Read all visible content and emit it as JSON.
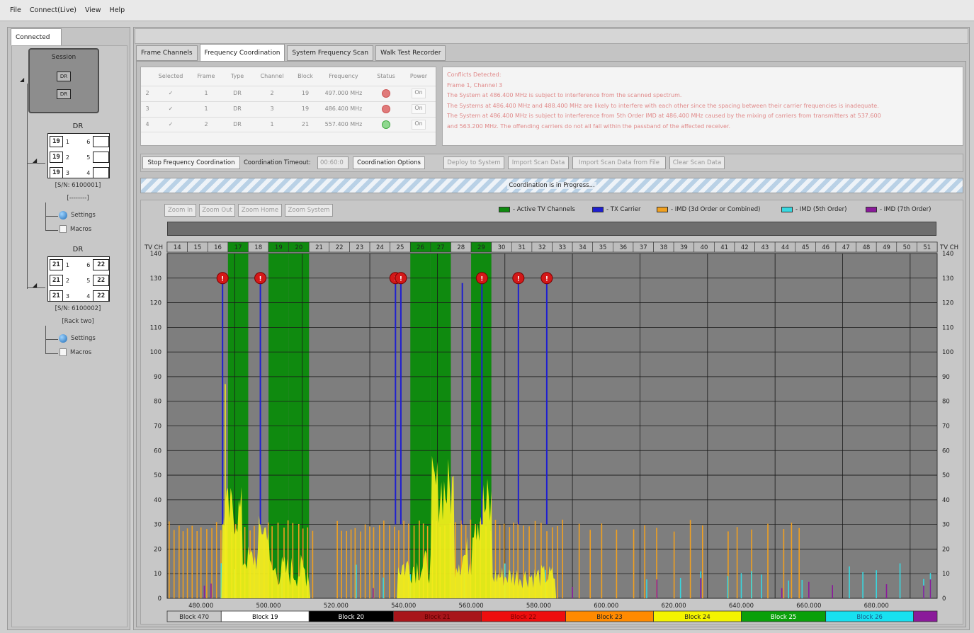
{
  "menu": [
    "File",
    "Connect(Live)",
    "View",
    "Help"
  ],
  "left": {
    "tab": "Connected",
    "session": {
      "label": "Session",
      "slots": [
        "DR",
        "DR"
      ]
    },
    "devices": [
      {
        "title": "DR",
        "rows": [
          [
            "19",
            "1",
            "6"
          ],
          [
            "19",
            "2",
            "5"
          ],
          [
            "19",
            "3",
            "4"
          ]
        ],
        "sn": "[S/N: 6100001]",
        "name": "[--------]"
      },
      {
        "title": "DR",
        "rows": [
          [
            "21",
            "1",
            "6",
            "22"
          ],
          [
            "21",
            "2",
            "5",
            "22"
          ],
          [
            "21",
            "3",
            "4",
            "22"
          ]
        ],
        "sn": "[S/N: 6100002]",
        "name": "[Rack two]"
      }
    ],
    "settings": "Settings",
    "macros": "Macros"
  },
  "tabs": [
    "Frame Channels",
    "Frequency Coordination",
    "System Frequency Scan",
    "Walk Test Recorder"
  ],
  "table": {
    "headers": [
      "Selected",
      "Frame",
      "Type",
      "Channel",
      "Block",
      "Frequency",
      "Status",
      "Power"
    ],
    "rows": [
      {
        "idx": "2",
        "selected": "✓",
        "frame": "1",
        "type": "DR",
        "channel": "2",
        "block": "19",
        "frequency": "497.000 MHz",
        "status": "red",
        "power": "On"
      },
      {
        "idx": "3",
        "selected": "✓",
        "frame": "1",
        "type": "DR",
        "channel": "3",
        "block": "19",
        "frequency": "486.400 MHz",
        "status": "red",
        "power": "On"
      },
      {
        "idx": "4",
        "selected": "✓",
        "frame": "2",
        "type": "DR",
        "channel": "1",
        "block": "21",
        "frequency": "557.400 MHz",
        "status": "green",
        "power": "On"
      }
    ]
  },
  "conflicts": [
    "Conflicts Detected:",
    "",
    "Frame 1, Channel 3",
    "The System at 486.400 MHz is subject to interference from the scanned spectrum.",
    "The Systems at 486.400 MHz and 488.400 MHz are likely to interfere with each other since the spacing between their carrier frequencies is inadequate.",
    "The System at 486.400 MHz is subject to interference from 5th Order IMD at 486.400 MHz caused by the mixing of carriers from transmitters at 537.600",
    "and 563.200 MHz. The offending carriers do not all fall within the passband of the affected receiver."
  ],
  "controls": {
    "stop": "Stop Frequency Coordination",
    "timeout_label": "Coordination Timeout:",
    "timeout_value": "00:60:0",
    "options": "Coordination Options",
    "deploy": "Deploy to System",
    "import_scan": "Import Scan Data",
    "import_file": "Import Scan Data from File",
    "clear": "Clear Scan Data"
  },
  "progress": "Coordination is in Progress...",
  "zoom": [
    "Zoom In",
    "Zoom Out",
    "Zoom Home",
    "Zoom System"
  ],
  "legend": [
    {
      "label": "- Active TV Channels",
      "color": "#0f8a0f"
    },
    {
      "label": "- TX Carrier",
      "color": "#1f1fcf"
    },
    {
      "label": "- IMD (3d Order or Combined)",
      "color": "#f0a020"
    },
    {
      "label": "- IMD (5th Order)",
      "color": "#38d8e0"
    },
    {
      "label": "- IMD (7th Order)",
      "color": "#8a1a9a"
    }
  ],
  "chart_data": {
    "type": "bar",
    "tv_ch_label": "TV CH",
    "tv_channels": [
      "14",
      "15",
      "16",
      "17",
      "18",
      "19",
      "20",
      "21",
      "22",
      "23",
      "24",
      "25",
      "26",
      "27",
      "28",
      "29",
      "30",
      "31",
      "32",
      "33",
      "34",
      "35",
      "36",
      "37",
      "38",
      "39",
      "40",
      "41",
      "42",
      "43",
      "44",
      "45",
      "46",
      "47",
      "48",
      "49",
      "50",
      "51"
    ],
    "active_tv_channels": [
      "17",
      "19",
      "20",
      "26",
      "27",
      "29"
    ],
    "xlim": [
      470,
      698
    ],
    "ylim": [
      0,
      140
    ],
    "yticks": [
      0,
      10,
      20,
      30,
      40,
      50,
      60,
      70,
      80,
      90,
      100,
      110,
      120,
      130,
      140
    ],
    "y_tick_labels": [
      "0",
      "10",
      "20",
      "30",
      "40",
      "50",
      "60",
      "70",
      "80",
      "90",
      "100",
      "110",
      "120",
      "130",
      "140"
    ],
    "xticks": [
      480,
      500,
      520,
      540,
      560,
      580,
      600,
      620,
      640,
      660,
      680
    ],
    "x_tick_labels": [
      "480.000",
      "500.000",
      "520.000",
      "540.000",
      "560.000",
      "580.000",
      "600.000",
      "620.000",
      "640.000",
      "660.000",
      "680.000"
    ],
    "tx_carriers": [
      {
        "freq": 486.4,
        "level": 130,
        "conflict": true
      },
      {
        "freq": 497.6,
        "level": 130,
        "conflict": true
      },
      {
        "freq": 537.6,
        "level": 130,
        "conflict": true
      },
      {
        "freq": 539.2,
        "level": 130,
        "conflict": true
      },
      {
        "freq": 557.4,
        "level": 128,
        "conflict": false
      },
      {
        "freq": 563.2,
        "level": 130,
        "conflict": true
      },
      {
        "freq": 574.0,
        "level": 130,
        "conflict": true
      },
      {
        "freq": 582.4,
        "level": 130,
        "conflict": true
      }
    ],
    "blocks": [
      {
        "name": "Block 470",
        "start": 470,
        "end": 486,
        "color": "#c8c8c8",
        "text": "#222"
      },
      {
        "name": "Block 19",
        "start": 486,
        "end": 512,
        "color": "#ffffff",
        "text": "#000"
      },
      {
        "name": "Block 20",
        "start": 512,
        "end": 537,
        "color": "#000000",
        "text": "#ffffff"
      },
      {
        "name": "Block 21",
        "start": 537,
        "end": 563,
        "color": "#a8151a",
        "text": "#5a0000"
      },
      {
        "name": "Block 22",
        "start": 563,
        "end": 588,
        "color": "#ee0e0e",
        "text": "#7a0000"
      },
      {
        "name": "Block 23",
        "start": 588,
        "end": 614,
        "color": "#ff8a00",
        "text": "#222"
      },
      {
        "name": "Block 24",
        "start": 614,
        "end": 640,
        "color": "#f4f400",
        "text": "#222"
      },
      {
        "name": "Block 25",
        "start": 640,
        "end": 665,
        "color": "#0aa00a",
        "text": "#ffffff"
      },
      {
        "name": "Block 26",
        "start": 665,
        "end": 691,
        "color": "#18e0f0",
        "text": "#1a5a8a"
      },
      {
        "name": "",
        "start": 691,
        "end": 698,
        "color": "#8a1a9a",
        "text": "#fff"
      }
    ]
  }
}
